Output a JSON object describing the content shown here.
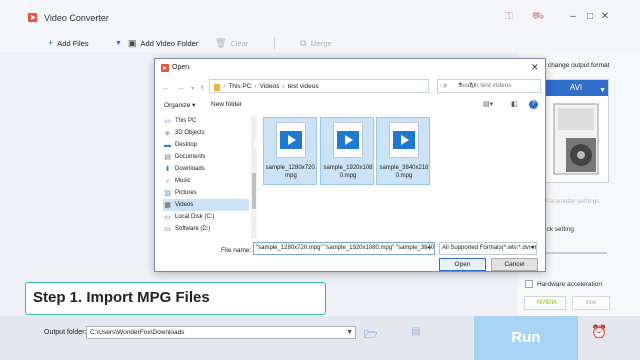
{
  "app": {
    "title": "Video Converter",
    "icons": [
      "key-icon",
      "cart-icon",
      "minimize-icon",
      "maximize-icon",
      "close-icon"
    ]
  },
  "toolbar": {
    "add_files": "Add Files",
    "add_video_folder": "Add Video Folder",
    "clear": "Clear",
    "merge": "Merge"
  },
  "side_panel": {
    "output_format_label": "change output format",
    "format_name": "AVI",
    "parameter_settings": "Parameter settings",
    "quick_setting": "ick setting",
    "hardware_acceleration": "Hardware acceleration",
    "nvidia": "NVIDIA",
    "intel": "intel"
  },
  "bottom": {
    "output_folder_label": "Output folder:",
    "output_folder_value": "C:\\Users\\WonderFox\\Downloads",
    "run": "Run"
  },
  "step_banner": "Step 1. Import MPG Files",
  "dialog": {
    "title": "Open",
    "breadcrumb": [
      "This PC",
      "Videos",
      "test videos"
    ],
    "search_placeholder": "Search test videos",
    "organize": "Organize ▾",
    "new_folder": "New folder",
    "nav_items": [
      {
        "label": "This PC",
        "icon": "computer-icon"
      },
      {
        "label": "3D Objects",
        "icon": "cube-icon"
      },
      {
        "label": "Desktop",
        "icon": "desktop-icon"
      },
      {
        "label": "Documents",
        "icon": "document-icon"
      },
      {
        "label": "Downloads",
        "icon": "download-icon"
      },
      {
        "label": "Music",
        "icon": "music-icon"
      },
      {
        "label": "Pictures",
        "icon": "picture-icon"
      },
      {
        "label": "Videos",
        "icon": "video-icon"
      },
      {
        "label": "Local Disk (C:)",
        "icon": "disk-icon"
      },
      {
        "label": "Software (D:)",
        "icon": "disk-icon"
      }
    ],
    "selected_nav": "Videos",
    "files": [
      {
        "name": "sample_1280x720.mpg"
      },
      {
        "name": "sample_1920x1080.mpg"
      },
      {
        "name": "sample_3840x2160.mpg"
      }
    ],
    "file_name_label": "File name:",
    "file_name_value": "\"sample_1280x720.mpg\" \"sample_1920x1080.mpg\" \"sample_3840x2160.mpg\"",
    "file_type": "All Supported Formats(*.wtv;*.dvr-ms",
    "open": "Open",
    "cancel": "Cancel"
  }
}
